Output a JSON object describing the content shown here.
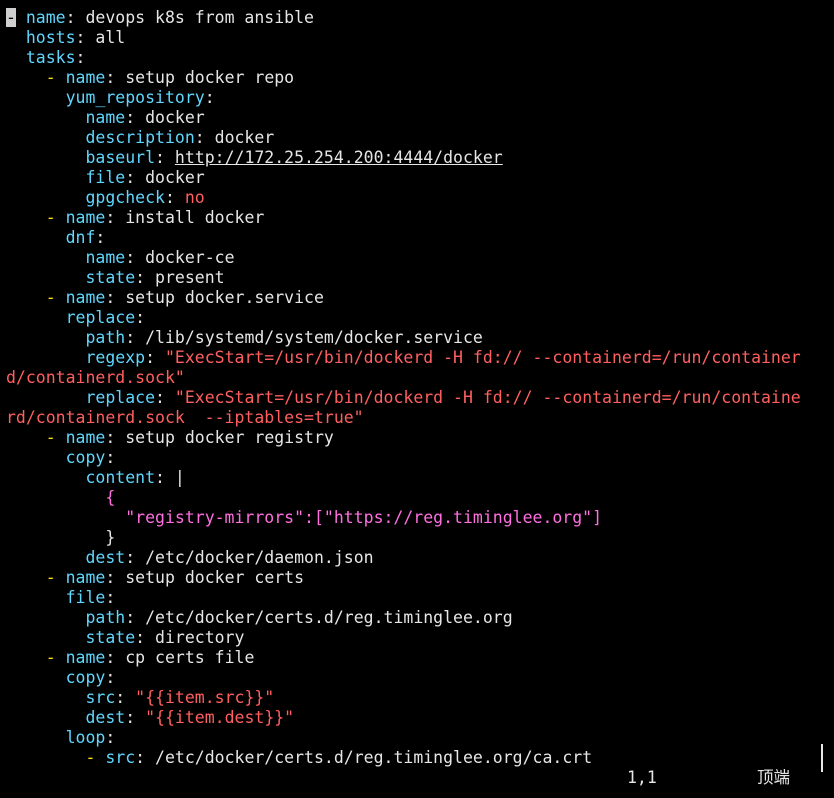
{
  "editor": {
    "lines": [
      [
        {
          "t": "-",
          "c": "cursor"
        },
        {
          "t": " ",
          "c": "p"
        },
        {
          "t": "name",
          "c": "k"
        },
        {
          "t": ": devops k8s from ansible",
          "c": "p"
        }
      ],
      [
        {
          "t": "  ",
          "c": "p"
        },
        {
          "t": "hosts",
          "c": "k"
        },
        {
          "t": ": all",
          "c": "p"
        }
      ],
      [
        {
          "t": "  ",
          "c": "p"
        },
        {
          "t": "tasks",
          "c": "k"
        },
        {
          "t": ":",
          "c": "p"
        }
      ],
      [
        {
          "t": "    ",
          "c": "p"
        },
        {
          "t": "-",
          "c": "y"
        },
        {
          "t": " ",
          "c": "p"
        },
        {
          "t": "name",
          "c": "k"
        },
        {
          "t": ": setup docker repo",
          "c": "p"
        }
      ],
      [
        {
          "t": "      ",
          "c": "p"
        },
        {
          "t": "yum_repository",
          "c": "k"
        },
        {
          "t": ":",
          "c": "p"
        }
      ],
      [
        {
          "t": "        ",
          "c": "p"
        },
        {
          "t": "name",
          "c": "k"
        },
        {
          "t": ": docker",
          "c": "p"
        }
      ],
      [
        {
          "t": "        ",
          "c": "p"
        },
        {
          "t": "description",
          "c": "k"
        },
        {
          "t": ": docker",
          "c": "p"
        }
      ],
      [
        {
          "t": "        ",
          "c": "p"
        },
        {
          "t": "baseurl",
          "c": "k"
        },
        {
          "t": ": ",
          "c": "p"
        },
        {
          "t": "http://172.25.254.200:4444/docker",
          "c": "u"
        }
      ],
      [
        {
          "t": "        ",
          "c": "p"
        },
        {
          "t": "file",
          "c": "k"
        },
        {
          "t": ": docker",
          "c": "p"
        }
      ],
      [
        {
          "t": "        ",
          "c": "p"
        },
        {
          "t": "gpgcheck",
          "c": "k"
        },
        {
          "t": ": ",
          "c": "p"
        },
        {
          "t": "no",
          "c": "s"
        }
      ],
      [
        {
          "t": "    ",
          "c": "p"
        },
        {
          "t": "-",
          "c": "y"
        },
        {
          "t": " ",
          "c": "p"
        },
        {
          "t": "name",
          "c": "k"
        },
        {
          "t": ": install docker",
          "c": "p"
        }
      ],
      [
        {
          "t": "      ",
          "c": "p"
        },
        {
          "t": "dnf",
          "c": "k"
        },
        {
          "t": ":",
          "c": "p"
        }
      ],
      [
        {
          "t": "        ",
          "c": "p"
        },
        {
          "t": "name",
          "c": "k"
        },
        {
          "t": ": docker-ce",
          "c": "p"
        }
      ],
      [
        {
          "t": "        ",
          "c": "p"
        },
        {
          "t": "state",
          "c": "k"
        },
        {
          "t": ": present",
          "c": "p"
        }
      ],
      [
        {
          "t": "    ",
          "c": "p"
        },
        {
          "t": "-",
          "c": "y"
        },
        {
          "t": " ",
          "c": "p"
        },
        {
          "t": "name",
          "c": "k"
        },
        {
          "t": ": setup docker.service",
          "c": "p"
        }
      ],
      [
        {
          "t": "      ",
          "c": "p"
        },
        {
          "t": "replace",
          "c": "k"
        },
        {
          "t": ":",
          "c": "p"
        }
      ],
      [
        {
          "t": "        ",
          "c": "p"
        },
        {
          "t": "path",
          "c": "k"
        },
        {
          "t": ": /lib/systemd/system/docker.service",
          "c": "p"
        }
      ],
      [
        {
          "t": "        ",
          "c": "p"
        },
        {
          "t": "regexp",
          "c": "k"
        },
        {
          "t": ": ",
          "c": "p"
        },
        {
          "t": "\"ExecStart=/usr/bin/dockerd -H fd:// --containerd=/run/container",
          "c": "s"
        }
      ],
      [
        {
          "t": "d/containerd.sock\"",
          "c": "s"
        }
      ],
      [
        {
          "t": "        ",
          "c": "p"
        },
        {
          "t": "replace",
          "c": "k"
        },
        {
          "t": ": ",
          "c": "p"
        },
        {
          "t": "\"ExecStart=/usr/bin/dockerd -H fd:// --containerd=/run/containe",
          "c": "s"
        }
      ],
      [
        {
          "t": "rd/containerd.sock  --iptables=true\"",
          "c": "s"
        }
      ],
      [
        {
          "t": "    ",
          "c": "p"
        },
        {
          "t": "-",
          "c": "y"
        },
        {
          "t": " ",
          "c": "p"
        },
        {
          "t": "name",
          "c": "k"
        },
        {
          "t": ": setup docker registry",
          "c": "p"
        }
      ],
      [
        {
          "t": "      ",
          "c": "p"
        },
        {
          "t": "copy",
          "c": "k"
        },
        {
          "t": ":",
          "c": "p"
        }
      ],
      [
        {
          "t": "        ",
          "c": "p"
        },
        {
          "t": "content",
          "c": "k"
        },
        {
          "t": ": |",
          "c": "p"
        }
      ],
      [
        {
          "t": "          ",
          "c": "p"
        },
        {
          "t": "{",
          "c": "m"
        }
      ],
      [
        {
          "t": "            ",
          "c": "p"
        },
        {
          "t": "\"registry-mirrors\":[\"https://reg.timinglee.org\"]",
          "c": "m"
        }
      ],
      [
        {
          "t": "          ",
          "c": "p"
        },
        {
          "t": "}",
          "c": "p"
        }
      ],
      [
        {
          "t": "        ",
          "c": "p"
        },
        {
          "t": "dest",
          "c": "k"
        },
        {
          "t": ": /etc/docker/daemon.json",
          "c": "p"
        }
      ],
      [
        {
          "t": "    ",
          "c": "p"
        },
        {
          "t": "-",
          "c": "y"
        },
        {
          "t": " ",
          "c": "p"
        },
        {
          "t": "name",
          "c": "k"
        },
        {
          "t": ": setup docker certs",
          "c": "p"
        }
      ],
      [
        {
          "t": "      ",
          "c": "p"
        },
        {
          "t": "file",
          "c": "k"
        },
        {
          "t": ":",
          "c": "p"
        }
      ],
      [
        {
          "t": "        ",
          "c": "p"
        },
        {
          "t": "path",
          "c": "k"
        },
        {
          "t": ": /etc/docker/certs.d/reg.timinglee.org",
          "c": "p"
        }
      ],
      [
        {
          "t": "        ",
          "c": "p"
        },
        {
          "t": "state",
          "c": "k"
        },
        {
          "t": ": directory",
          "c": "p"
        }
      ],
      [
        {
          "t": "    ",
          "c": "p"
        },
        {
          "t": "-",
          "c": "y"
        },
        {
          "t": " ",
          "c": "p"
        },
        {
          "t": "name",
          "c": "k"
        },
        {
          "t": ": cp certs file",
          "c": "p"
        }
      ],
      [
        {
          "t": "      ",
          "c": "p"
        },
        {
          "t": "copy",
          "c": "k"
        },
        {
          "t": ":",
          "c": "p"
        }
      ],
      [
        {
          "t": "        ",
          "c": "p"
        },
        {
          "t": "src",
          "c": "k"
        },
        {
          "t": ": ",
          "c": "p"
        },
        {
          "t": "\"{{item.src}}\"",
          "c": "s"
        }
      ],
      [
        {
          "t": "        ",
          "c": "p"
        },
        {
          "t": "dest",
          "c": "k"
        },
        {
          "t": ": ",
          "c": "p"
        },
        {
          "t": "\"{{item.dest}}\"",
          "c": "s"
        }
      ],
      [
        {
          "t": "      ",
          "c": "p"
        },
        {
          "t": "loop",
          "c": "k"
        },
        {
          "t": ":",
          "c": "p"
        }
      ],
      [
        {
          "t": "        ",
          "c": "p"
        },
        {
          "t": "-",
          "c": "y"
        },
        {
          "t": " ",
          "c": "p"
        },
        {
          "t": "src",
          "c": "k"
        },
        {
          "t": ": /etc/docker/certs.d/reg.timinglee.org/ca.crt",
          "c": "p"
        }
      ]
    ]
  },
  "status": {
    "cursor_position": "1,1",
    "scroll_position": "顶端"
  },
  "colors": {
    "background": "#000000",
    "key": "#5fd7ff",
    "dash": "#ffdf00",
    "string": "#ff5f5f",
    "block_text": "#ff6fe0",
    "plain": "#e6e6e6"
  }
}
